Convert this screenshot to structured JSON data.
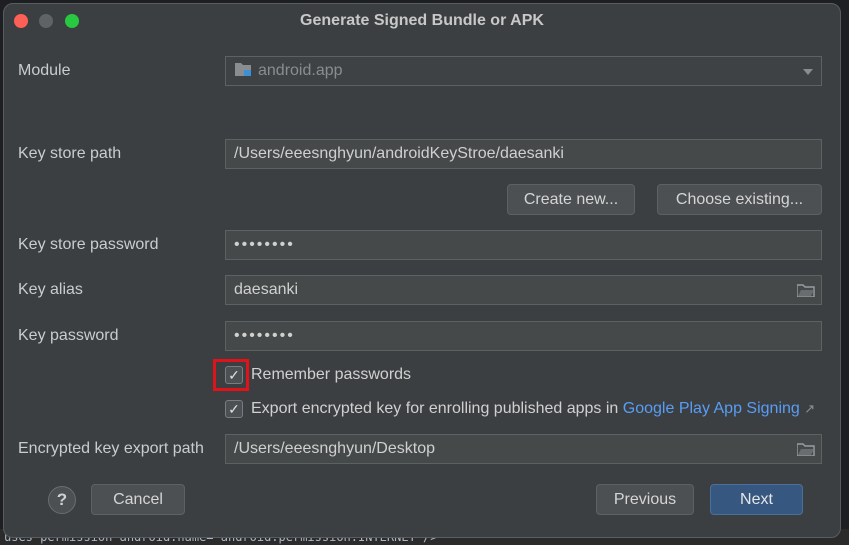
{
  "background": {
    "code_line": "uses-permission android:name=\"android.permission.INTERNET\"/>"
  },
  "dialog": {
    "title": "Generate Signed Bundle or APK",
    "module": {
      "label": "Module",
      "value": "android.app"
    },
    "key_store_path": {
      "label": "Key store path",
      "value": "/Users/eeesnghyun/androidKeyStroe/daesanki"
    },
    "create_new": "Create new...",
    "choose_existing": "Choose existing...",
    "key_store_password": {
      "label": "Key store password",
      "value": "••••••••"
    },
    "key_alias": {
      "label": "Key alias",
      "value": "daesanki"
    },
    "key_password": {
      "label": "Key password",
      "value": "••••••••"
    },
    "remember_passwords": {
      "label": "Remember passwords",
      "checked": true
    },
    "export_key": {
      "label": "Export encrypted key for enrolling published apps in",
      "link": "Google Play App Signing",
      "link_arrow": "↗",
      "checked": true
    },
    "export_path": {
      "label": "Encrypted key export path",
      "value": "/Users/eeesnghyun/Desktop"
    },
    "help": "?",
    "cancel": "Cancel",
    "previous": "Previous",
    "next": "Next",
    "checkmark": "✓"
  },
  "colors": {
    "accent": "#365880",
    "link": "#589df6",
    "highlight": "#e0131a"
  }
}
